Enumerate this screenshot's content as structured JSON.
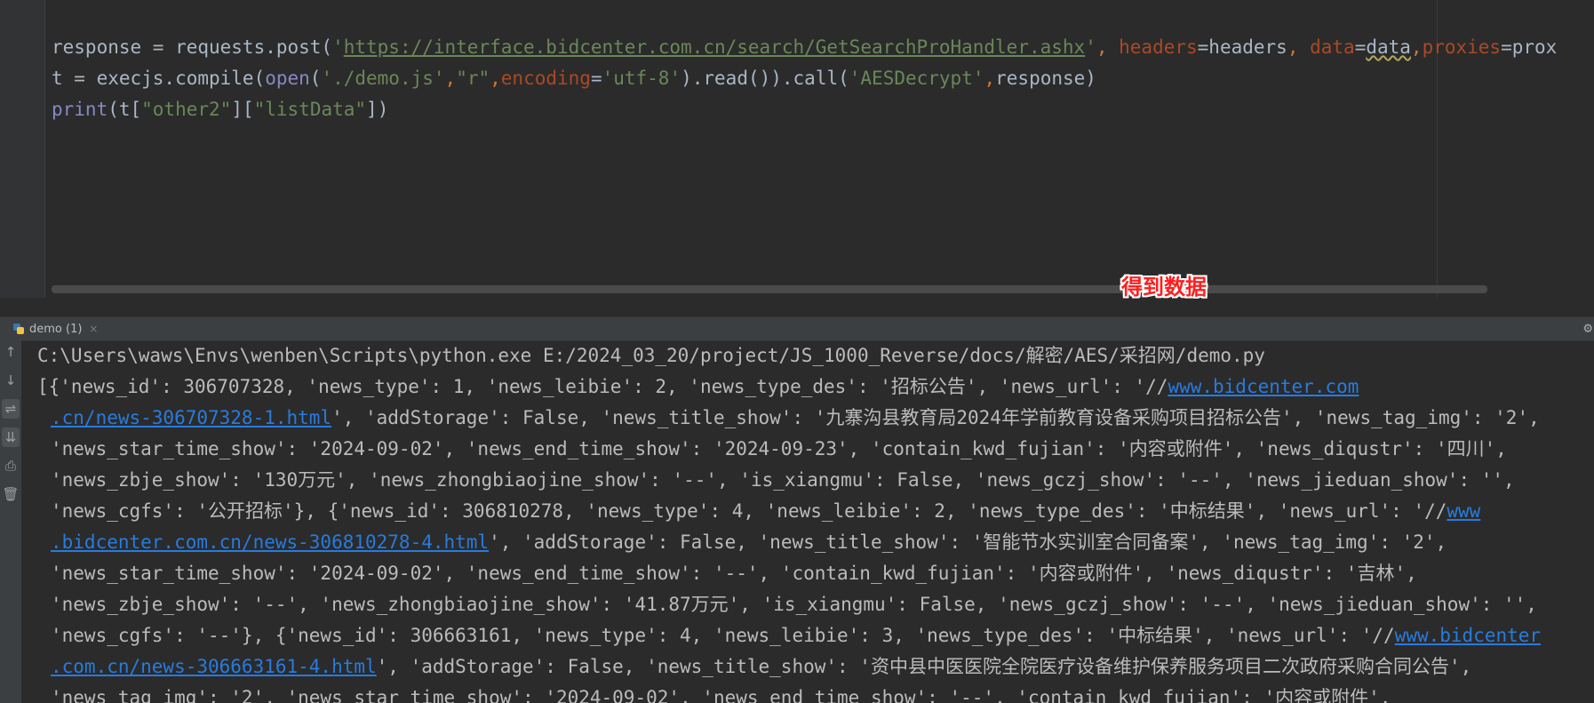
{
  "editor": {
    "code_lines": [
      [
        {
          "t": "response = requests.post(",
          "c": ""
        },
        {
          "t": "'",
          "c": "str"
        },
        {
          "t": "https://interface.bidcenter.com.cn/search/GetSearchProHandler.ashx",
          "c": "str-url"
        },
        {
          "t": "'",
          "c": "str"
        },
        {
          "t": ", ",
          "c": "kw"
        },
        {
          "t": "headers",
          "c": "param"
        },
        {
          "t": "=headers",
          "c": ""
        },
        {
          "t": ", ",
          "c": "kw"
        },
        {
          "t": "data",
          "c": "param"
        },
        {
          "t": "=",
          "c": ""
        },
        {
          "t": "data",
          "c": "wavy"
        },
        {
          "t": ",",
          "c": "kw"
        },
        {
          "t": "proxies",
          "c": "param"
        },
        {
          "t": "=prox",
          "c": ""
        }
      ],
      [
        {
          "t": "t = execjs.compile(",
          "c": ""
        },
        {
          "t": "open",
          "c": "builtin"
        },
        {
          "t": "(",
          "c": ""
        },
        {
          "t": "'./demo.js'",
          "c": "str"
        },
        {
          "t": ",",
          "c": "kw"
        },
        {
          "t": "\"r\"",
          "c": "str"
        },
        {
          "t": ",",
          "c": "kw"
        },
        {
          "t": "encoding",
          "c": "param"
        },
        {
          "t": "=",
          "c": ""
        },
        {
          "t": "'utf-8'",
          "c": "str"
        },
        {
          "t": ").read()).call(",
          "c": ""
        },
        {
          "t": "'AESDecrypt'",
          "c": "str"
        },
        {
          "t": ",",
          "c": "kw"
        },
        {
          "t": "response)",
          "c": ""
        }
      ],
      [
        {
          "t": "print",
          "c": "builtin"
        },
        {
          "t": "(t[",
          "c": ""
        },
        {
          "t": "\"other2\"",
          "c": "str"
        },
        {
          "t": "][",
          "c": ""
        },
        {
          "t": "\"listData\"",
          "c": "str"
        },
        {
          "t": "])",
          "c": ""
        }
      ]
    ],
    "annotation": "得到数据"
  },
  "run_panel": {
    "tab_label": "demo (1)",
    "tab_close": "×",
    "gear_icon": "gear-icon",
    "tools": [
      {
        "name": "up-arrow-icon",
        "glyph": "↑"
      },
      {
        "name": "down-arrow-icon",
        "glyph": "↓"
      },
      {
        "name": "soft-wrap-icon",
        "glyph": "⇌",
        "active": true
      },
      {
        "name": "scroll-to-end-icon",
        "glyph": "⇊",
        "active": true
      },
      {
        "name": "print-icon",
        "glyph": "⎙"
      },
      {
        "name": "trash-icon",
        "glyph": "🗑"
      }
    ],
    "console_lines": [
      {
        "indent": false,
        "parts": [
          {
            "t": "C:\\Users\\waws\\Envs\\wenben\\Scripts\\python.exe E:/2024_03_20/project/JS_1000_Reverse/docs/解密/AES/采招网/demo.py"
          }
        ]
      },
      {
        "indent": false,
        "parts": [
          {
            "t": "[{'news_id': 306707328, 'news_type': 1, 'news_leibie': 2, 'news_type_des': '招标公告', 'news_url': '//"
          },
          {
            "t": "www.bidcenter.com",
            "link": true
          }
        ]
      },
      {
        "indent": true,
        "parts": [
          {
            "t": ".cn/news-306707328-1.html",
            "link": true
          },
          {
            "t": "', 'addStorage': False, 'news_title_show': '九寨沟县教育局2024年学前教育设备采购项目招标公告', 'news_tag_img': '2',"
          }
        ]
      },
      {
        "indent": true,
        "parts": [
          {
            "t": "'news_star_time_show': '2024-09-02', 'news_end_time_show': '2024-09-23', 'contain_kwd_fujian': '内容或附件', 'news_diqustr': '四川',"
          }
        ]
      },
      {
        "indent": true,
        "parts": [
          {
            "t": "'news_zbje_show': '130万元', 'news_zhongbiaojine_show': '--', 'is_xiangmu': False, 'news_gczj_show': '--', 'news_jieduan_show': '',"
          }
        ]
      },
      {
        "indent": true,
        "parts": [
          {
            "t": "'news_cgfs': '公开招标'}, {'news_id': 306810278, 'news_type': 4, 'news_leibie': 2, 'news_type_des': '中标结果', 'news_url': '//"
          },
          {
            "t": "www",
            "link": true
          }
        ]
      },
      {
        "indent": true,
        "parts": [
          {
            "t": ".bidcenter.com.cn/news-306810278-4.html",
            "link": true
          },
          {
            "t": "', 'addStorage': False, 'news_title_show': '智能节水实训室合同备案', 'news_tag_img': '2',"
          }
        ]
      },
      {
        "indent": true,
        "parts": [
          {
            "t": "'news_star_time_show': '2024-09-02', 'news_end_time_show': '--', 'contain_kwd_fujian': '内容或附件', 'news_diqustr': '吉林',"
          }
        ]
      },
      {
        "indent": true,
        "parts": [
          {
            "t": "'news_zbje_show': '--', 'news_zhongbiaojine_show': '41.87万元', 'is_xiangmu': False, 'news_gczj_show': '--', 'news_jieduan_show': '',"
          }
        ]
      },
      {
        "indent": true,
        "parts": [
          {
            "t": "'news_cgfs': '--'}, {'news_id': 306663161, 'news_type': 4, 'news_leibie': 3, 'news_type_des': '中标结果', 'news_url': '//"
          },
          {
            "t": "www.bidcenter",
            "link": true
          }
        ]
      },
      {
        "indent": true,
        "parts": [
          {
            "t": ".com.cn/news-306663161-4.html",
            "link": true
          },
          {
            "t": "', 'addStorage': False, 'news_title_show': '资中县中医医院全院医疗设备维护保养服务项目二次政府采购合同公告',"
          }
        ]
      },
      {
        "indent": true,
        "parts": [
          {
            "t": "'news_tag_img': '2', 'news_star_time_show': '2024-09-02', 'news_end_time_show': '--', 'contain_kwd_fujian': '内容或附件',"
          }
        ]
      }
    ]
  }
}
